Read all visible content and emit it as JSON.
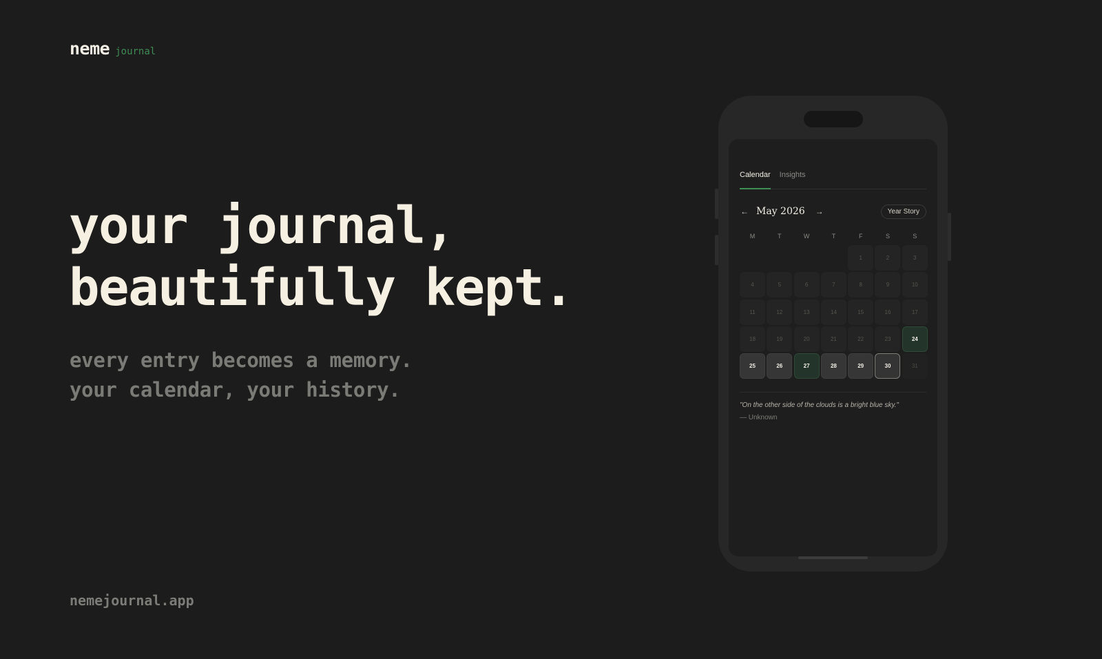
{
  "brand": {
    "name": "neme",
    "sub": "journal"
  },
  "hero": {
    "line1": "your journal,",
    "line2": "beautifully kept.",
    "sub1": "every entry becomes a memory.",
    "sub2": "your calendar, your history."
  },
  "footer": {
    "url": "nemejournal.app"
  },
  "colors": {
    "background": "#1c1c1c",
    "accent_green": "#3e8e56",
    "cream": "#f4efe4"
  },
  "app": {
    "tabs": [
      {
        "label": "Calendar",
        "active": true
      },
      {
        "label": "Insights",
        "active": false
      }
    ],
    "calendar": {
      "prev_icon": "←",
      "next_icon": "→",
      "month_label": "May 2026",
      "year_story_label": "Year Story",
      "weekdays": [
        "M",
        "T",
        "W",
        "T",
        "F",
        "S",
        "S"
      ],
      "leading_blanks": 4,
      "days": [
        {
          "d": "1",
          "s": "past"
        },
        {
          "d": "2",
          "s": "past"
        },
        {
          "d": "3",
          "s": "past"
        },
        {
          "d": "4",
          "s": "past"
        },
        {
          "d": "5",
          "s": "past"
        },
        {
          "d": "6",
          "s": "past"
        },
        {
          "d": "7",
          "s": "past"
        },
        {
          "d": "8",
          "s": "past"
        },
        {
          "d": "9",
          "s": "past"
        },
        {
          "d": "10",
          "s": "past"
        },
        {
          "d": "11",
          "s": "past"
        },
        {
          "d": "12",
          "s": "past"
        },
        {
          "d": "13",
          "s": "past"
        },
        {
          "d": "14",
          "s": "past"
        },
        {
          "d": "15",
          "s": "past"
        },
        {
          "d": "16",
          "s": "past"
        },
        {
          "d": "17",
          "s": "past"
        },
        {
          "d": "18",
          "s": "past"
        },
        {
          "d": "19",
          "s": "past"
        },
        {
          "d": "20",
          "s": "past"
        },
        {
          "d": "21",
          "s": "past"
        },
        {
          "d": "22",
          "s": "past"
        },
        {
          "d": "23",
          "s": "past"
        },
        {
          "d": "24",
          "s": "green"
        },
        {
          "d": "25",
          "s": "written"
        },
        {
          "d": "26",
          "s": "written"
        },
        {
          "d": "27",
          "s": "green"
        },
        {
          "d": "28",
          "s": "written"
        },
        {
          "d": "29",
          "s": "written"
        },
        {
          "d": "30",
          "s": "today"
        },
        {
          "d": "31",
          "s": "future"
        }
      ]
    },
    "quote": {
      "text": "\"On the other side of the clouds is a bright blue sky.\"",
      "author": "— Unknown"
    }
  }
}
